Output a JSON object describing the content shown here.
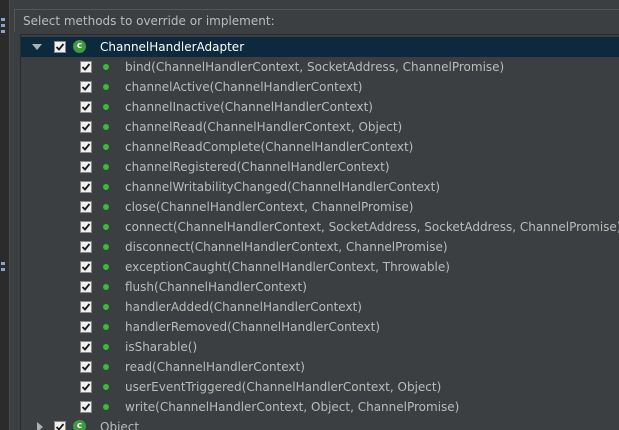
{
  "header": {
    "title": "Select methods to override or implement:"
  },
  "tree": {
    "root_class": {
      "name": "ChannelHandlerAdapter",
      "icon_letter": "c",
      "checked": true,
      "expanded": true
    },
    "methods": [
      {
        "label": "bind(ChannelHandlerContext, SocketAddress, ChannelPromise)",
        "checked": true
      },
      {
        "label": "channelActive(ChannelHandlerContext)",
        "checked": true
      },
      {
        "label": "channelInactive(ChannelHandlerContext)",
        "checked": true
      },
      {
        "label": "channelRead(ChannelHandlerContext, Object)",
        "checked": true
      },
      {
        "label": "channelReadComplete(ChannelHandlerContext)",
        "checked": true
      },
      {
        "label": "channelRegistered(ChannelHandlerContext)",
        "checked": true
      },
      {
        "label": "channelWritabilityChanged(ChannelHandlerContext)",
        "checked": true
      },
      {
        "label": "close(ChannelHandlerContext, ChannelPromise)",
        "checked": true
      },
      {
        "label": "connect(ChannelHandlerContext, SocketAddress, SocketAddress, ChannelPromise)",
        "checked": true
      },
      {
        "label": "disconnect(ChannelHandlerContext, ChannelPromise)",
        "checked": true
      },
      {
        "label": "exceptionCaught(ChannelHandlerContext, Throwable)",
        "checked": true
      },
      {
        "label": "flush(ChannelHandlerContext)",
        "checked": true
      },
      {
        "label": "handlerAdded(ChannelHandlerContext)",
        "checked": true
      },
      {
        "label": "handlerRemoved(ChannelHandlerContext)",
        "checked": true
      },
      {
        "label": "isSharable()",
        "checked": true
      },
      {
        "label": "read(ChannelHandlerContext)",
        "checked": true
      },
      {
        "label": "userEventTriggered(ChannelHandlerContext, Object)",
        "checked": true
      },
      {
        "label": "write(ChannelHandlerContext, Object, ChannelPromise)",
        "checked": true
      }
    ],
    "second_class": {
      "name": "Object",
      "icon_letter": "c",
      "checked": true,
      "expanded": false
    }
  },
  "colors": {
    "background": "#3c3f41",
    "selection": "#0d293e",
    "text": "#bbbbbb",
    "method_icon": "#3bba3b",
    "class_icon": "#3e9c3e"
  }
}
